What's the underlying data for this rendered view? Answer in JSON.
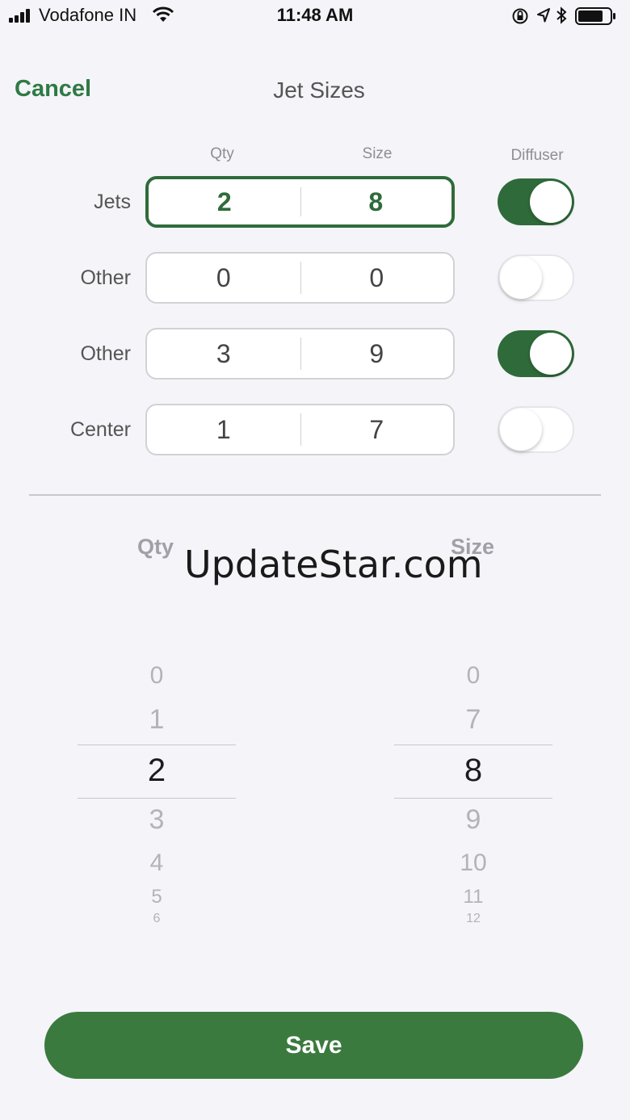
{
  "status_bar": {
    "carrier": "Vodafone IN",
    "time": "11:48 AM"
  },
  "nav": {
    "cancel_label": "Cancel",
    "title": "Jet Sizes"
  },
  "columns": {
    "qty": "Qty",
    "size": "Size",
    "diffuser": "Diffuser"
  },
  "rows": [
    {
      "label": "Jets",
      "qty": "2",
      "size": "8",
      "diffuser": true,
      "active": true
    },
    {
      "label": "Other",
      "qty": "0",
      "size": "0",
      "diffuser": false,
      "active": false
    },
    {
      "label": "Other",
      "qty": "3",
      "size": "9",
      "diffuser": true,
      "active": false
    },
    {
      "label": "Center",
      "qty": "1",
      "size": "7",
      "diffuser": false,
      "active": false
    }
  ],
  "picker": {
    "qty_label": "Qty",
    "size_label": "Size",
    "qty_items": [
      "0",
      "1",
      "2",
      "3",
      "4",
      "5",
      "6"
    ],
    "qty_selected": "2",
    "size_items": [
      "0",
      "7",
      "8",
      "9",
      "10",
      "11",
      "12"
    ],
    "size_selected": "8"
  },
  "watermark": "UpdateStar.com",
  "save_label": "Save",
  "colors": {
    "accent": "#2f6b3a",
    "save_button": "#3a7a3e",
    "background": "#f4f4f9"
  }
}
